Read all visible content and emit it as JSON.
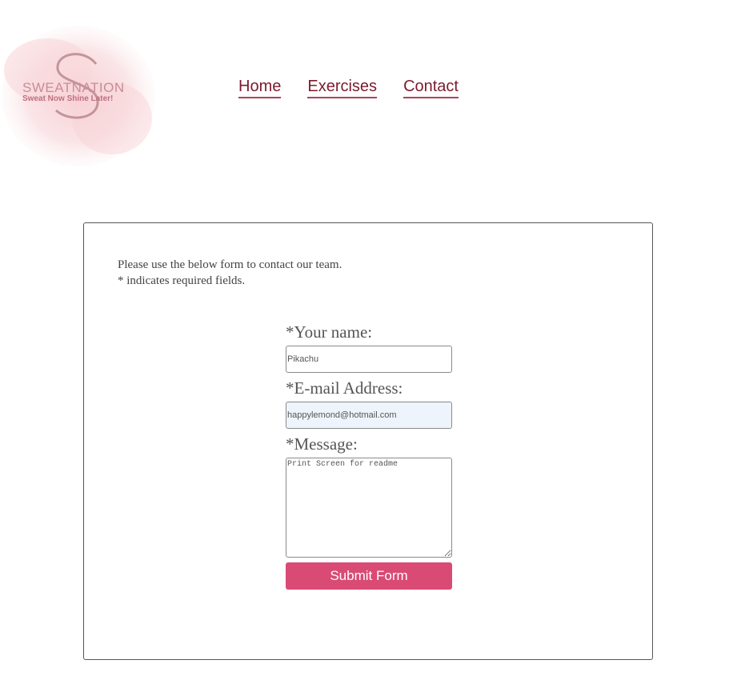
{
  "logo": {
    "title": "SWEATNATION",
    "tagline": "Sweat Now Shine Later!"
  },
  "nav": {
    "items": [
      {
        "label": "Home"
      },
      {
        "label": "Exercises"
      },
      {
        "label": "Contact"
      }
    ]
  },
  "intro": {
    "line1": "Please use the below form to contact our team.",
    "line2": "* indicates required fields."
  },
  "form": {
    "name_label": "*Your name:",
    "name_value": "Pikachu",
    "email_label": "*E-mail Address:",
    "email_value": "happylemond@hotmail.com",
    "message_label": "*Message:",
    "message_value": "Print Screen for readme",
    "submit_label": "Submit Form"
  },
  "colors": {
    "nav_text": "#7a1c2e",
    "nav_underline": "#b0405a",
    "submit_bg": "#d94b74",
    "logo_text": "#c88d95"
  }
}
